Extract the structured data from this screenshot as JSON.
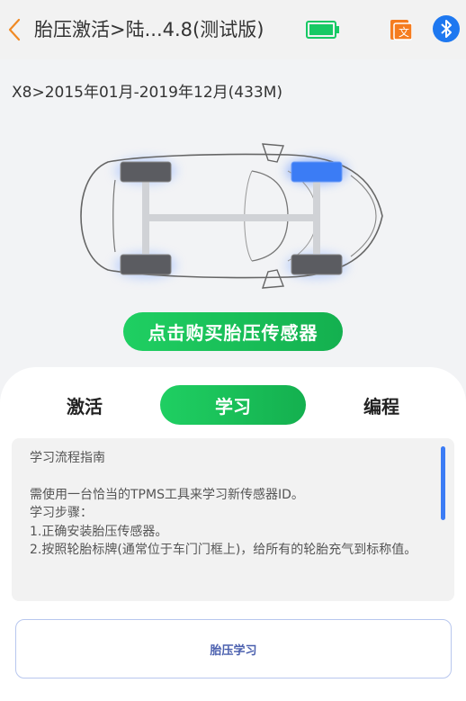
{
  "header": {
    "title": "胎压激活>陆...4.8(测试版)",
    "battery_color": "#17c964",
    "doc_icon_color": "#f57c1f",
    "bluetooth_color": "#1e78f0"
  },
  "vehicle": {
    "info": "X8>2015年01月-2019年12月(433M)"
  },
  "car_diagram": {
    "highlighted_wheel": "front-right",
    "highlight_color": "#3b7cf5"
  },
  "buy_button": {
    "label": "点击购买胎压传感器"
  },
  "tabs": [
    {
      "label": "激活",
      "active": false
    },
    {
      "label": "学习",
      "active": true
    },
    {
      "label": "编程",
      "active": false
    }
  ],
  "guide": {
    "title": "学习流程指南",
    "lines": [
      "需使用一台恰当的TPMS工具来学习新传感器ID。",
      "学习步骤：",
      "1.正确安装胎压传感器。",
      "2.按照轮胎标牌(通常位于车门门框上)，给所有的轮胎充气到标称值。"
    ]
  },
  "action_button": {
    "label": "胎压学习"
  }
}
